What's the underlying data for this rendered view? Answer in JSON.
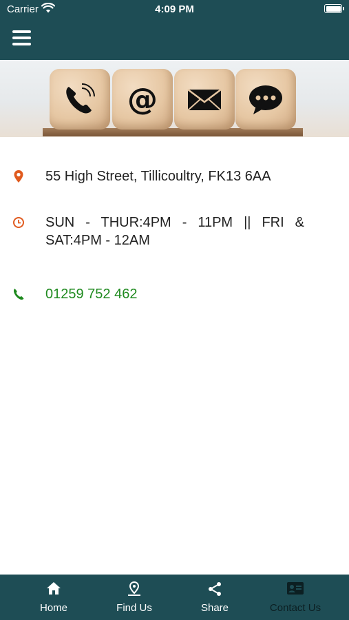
{
  "status_bar": {
    "carrier": "Carrier",
    "time": "4:09 PM"
  },
  "header": {
    "menu_icon": "hamburger-menu-icon"
  },
  "banner": {
    "icons": [
      "phone-icon",
      "at-icon",
      "envelope-icon",
      "chat-bubble-icon"
    ]
  },
  "contact": {
    "address": "55 High Street, Tillicoultry, FK13 6AA",
    "hours_line1": "SUN - THUR:4PM - 11PM || FRI &",
    "hours_line2": "SAT:4PM - 12AM",
    "phone": "01259 752 462"
  },
  "colors": {
    "primary": "#1e4d55",
    "accent_icon": "#e05a1e",
    "phone_green": "#1f8a1f"
  },
  "tabs": [
    {
      "label": "Home",
      "icon": "home-icon",
      "active": false
    },
    {
      "label": "Find Us",
      "icon": "map-pin-icon",
      "active": false
    },
    {
      "label": "Share",
      "icon": "share-icon",
      "active": false
    },
    {
      "label": "Contact Us",
      "icon": "contact-card-icon",
      "active": true
    }
  ]
}
